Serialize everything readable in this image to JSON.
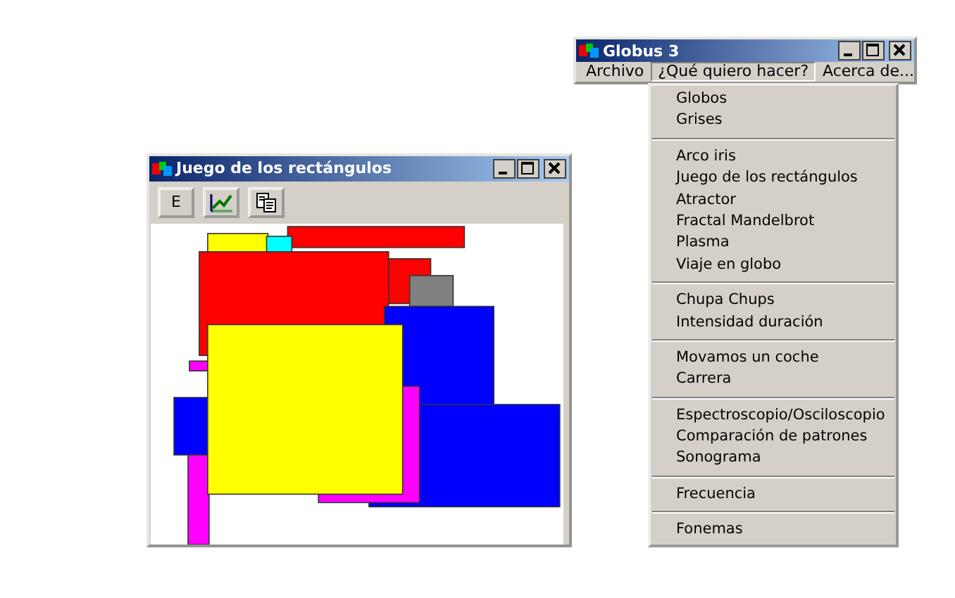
{
  "rect_window": {
    "title": "Juego de los rectángulos",
    "toolbar": [
      {
        "kind": "text",
        "label": "E"
      },
      {
        "kind": "chart"
      },
      {
        "kind": "copy"
      }
    ]
  },
  "globus_window": {
    "title": "Globus 3",
    "menu_bar": [
      {
        "label": "Archivo",
        "selected": false
      },
      {
        "label": "¿Qué quiero hacer?",
        "selected": true
      },
      {
        "label": "Acerca de...",
        "selected": false
      }
    ],
    "open_menu": [
      [
        "Globos",
        "Grises"
      ],
      [
        "Arco iris",
        "Juego de los rectángulos",
        "Atractor",
        "Fractal Mandelbrot",
        "Plasma",
        "Viaje en globo"
      ],
      [
        "Chupa Chups",
        "Intensidad duración"
      ],
      [
        "Movamos un coche",
        "Carrera"
      ],
      [
        "Espectroscopio/Osciloscopio",
        "Comparación de patrones",
        "Sonograma"
      ],
      [
        "Frecuencia"
      ],
      [
        "Fonemas"
      ]
    ]
  }
}
